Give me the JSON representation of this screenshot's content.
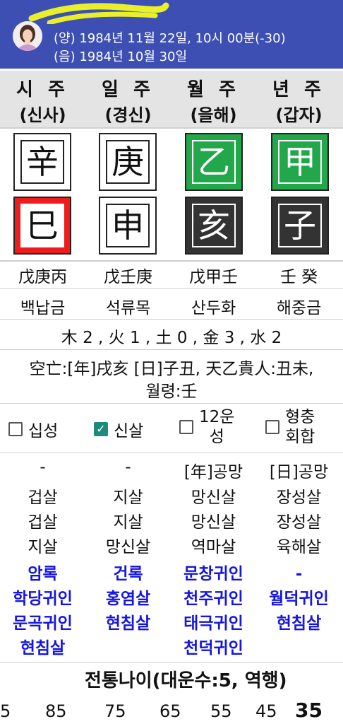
{
  "header": {
    "solar_line": "(양) 1984년 11월 22일, 10시 00분(-30)",
    "lunar_line": "(음) 1984년 10월 30일",
    "background_color": "#3d4fb3"
  },
  "pillars": [
    {
      "label": "시 주",
      "sub": "(신사)",
      "stem": "辛",
      "branch": "巳",
      "hidden": "戊庚丙",
      "napeum": "백납금"
    },
    {
      "label": "일 주",
      "sub": "(경신)",
      "stem": "庚",
      "branch": "申",
      "hidden": "戊壬庚",
      "napeum": "석류목"
    },
    {
      "label": "월 주",
      "sub": "(을해)",
      "stem": "乙",
      "branch": "亥",
      "hidden": "戊甲壬",
      "napeum": "산두화"
    },
    {
      "label": "년 주",
      "sub": "(갑자)",
      "stem": "甲",
      "branch": "子",
      "hidden": "壬 癸",
      "napeum": "해중금"
    }
  ],
  "elements_line": "木 2 , 火 1 , 土 0 , 金 3 , 水 2",
  "gongmang_line1": "空亡:[年]戌亥 [日]子丑, 天乙貴人:丑未,",
  "gongmang_line2": "월령:壬",
  "checkboxes": [
    {
      "label": "십성",
      "checked": false
    },
    {
      "label": "신살",
      "checked": true
    },
    {
      "label": "12운",
      "label2": "성",
      "checked": false
    },
    {
      "label": "형충",
      "label2": "회합",
      "checked": false
    }
  ],
  "sinsal": {
    "row0": [
      "-",
      "-",
      "[年]공망",
      "[日]공망"
    ],
    "row1": [
      "겁살",
      "지살",
      "망신살",
      "장성살"
    ],
    "row2": [
      "겁살",
      "지살",
      "망신살",
      "장성살"
    ],
    "row3": [
      "지살",
      "망신살",
      "역마살",
      "육해살"
    ],
    "blue": [
      [
        "암록",
        "학당귀인",
        "문곡귀인",
        "현침살"
      ],
      [
        "건록",
        "홍염살",
        "현침살"
      ],
      [
        "문창귀인",
        "천주귀인",
        "태극귀인",
        "천덕귀인"
      ],
      [
        "-",
        "월덕귀인",
        "현침살"
      ]
    ]
  },
  "daeun": {
    "title": "전통나이(대운수:5, 역행)",
    "ages": [
      "5",
      "85",
      "75",
      "65",
      "55",
      "45",
      "35"
    ]
  }
}
